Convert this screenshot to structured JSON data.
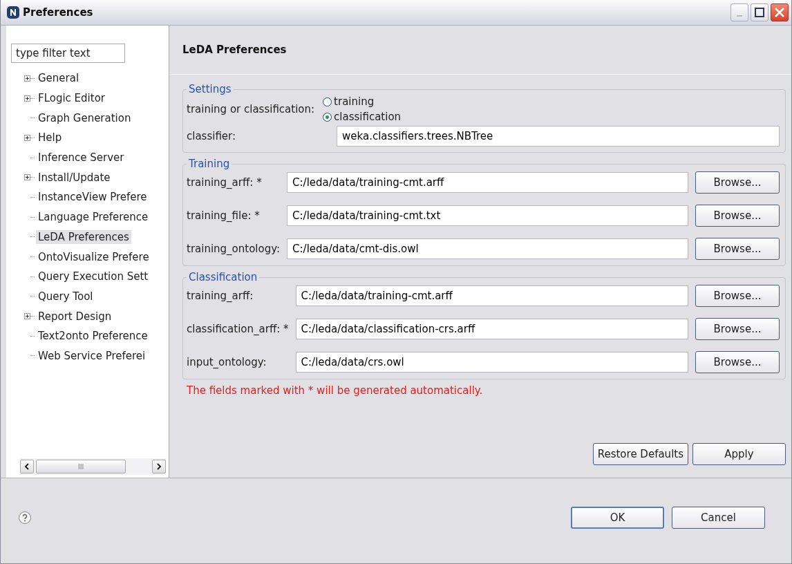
{
  "window": {
    "title": "Preferences"
  },
  "filter": {
    "placeholder": "type filter text"
  },
  "tree": [
    {
      "label": "General",
      "expandable": true,
      "selected": false
    },
    {
      "label": "FLogic Editor",
      "expandable": true,
      "selected": false
    },
    {
      "label": "Graph Generation",
      "expandable": false,
      "selected": false
    },
    {
      "label": "Help",
      "expandable": true,
      "selected": false
    },
    {
      "label": "Inference Server",
      "expandable": false,
      "selected": false
    },
    {
      "label": "Install/Update",
      "expandable": true,
      "selected": false
    },
    {
      "label": "InstanceView Prefere",
      "expandable": false,
      "selected": false
    },
    {
      "label": "Language Preference",
      "expandable": false,
      "selected": false
    },
    {
      "label": "LeDA Preferences",
      "expandable": false,
      "selected": true
    },
    {
      "label": "OntoVisualize Prefere",
      "expandable": false,
      "selected": false
    },
    {
      "label": "Query Execution Sett",
      "expandable": false,
      "selected": false
    },
    {
      "label": "Query Tool",
      "expandable": false,
      "selected": false
    },
    {
      "label": "Report Design",
      "expandable": true,
      "selected": false
    },
    {
      "label": "Text2onto Preference",
      "expandable": false,
      "selected": false
    },
    {
      "label": "Web Service Preferei",
      "expandable": false,
      "selected": false
    }
  ],
  "page_title": "LeDA Preferences",
  "settings": {
    "title": "Settings",
    "mode_label": "training or classification:",
    "options": [
      {
        "label": "training",
        "selected": false
      },
      {
        "label": "classification",
        "selected": true
      }
    ],
    "classifier_label": "classifier:",
    "classifier_value": "weka.classifiers.trees.NBTree"
  },
  "groups": [
    {
      "title": "Training",
      "rows": [
        {
          "label": "training_arff: *",
          "value": "C:/leda/data/training-cmt.arff",
          "button": "Browse..."
        },
        {
          "label": "training_file: *",
          "value": "C:/leda/data/training-cmt.txt",
          "button": "Browse..."
        },
        {
          "label": "training_ontology:",
          "value": "C:/leda/data/cmt-dis.owl",
          "button": "Browse..."
        }
      ]
    },
    {
      "title": "Classification",
      "rows": [
        {
          "label": "training_arff:",
          "value": "C:/leda/data/training-cmt.arff",
          "button": "Browse..."
        },
        {
          "label": "classification_arff: *",
          "value": "C:/leda/data/classification-crs.arff",
          "button": "Browse..."
        },
        {
          "label": "input_ontology:",
          "value": "C:/leda/data/crs.owl",
          "button": "Browse..."
        }
      ]
    }
  ],
  "note": "The fields marked with * will be generated automatically.",
  "page_buttons": [
    "Restore Defaults",
    "Apply"
  ],
  "dialog_buttons": [
    "OK",
    "Cancel"
  ]
}
